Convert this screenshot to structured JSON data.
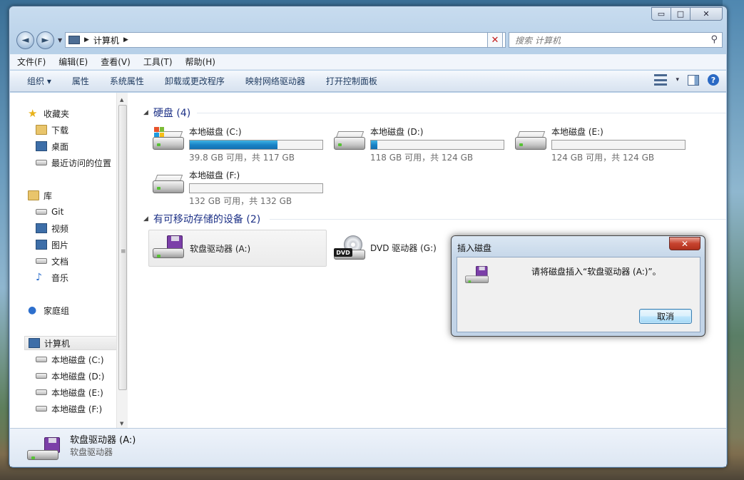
{
  "window": {
    "caption_buttons": {
      "minimize": "▭",
      "maximize": "□",
      "close": "✕"
    }
  },
  "navbar": {
    "back_glyph": "◄",
    "forward_glyph": "►",
    "address_path": "计算机",
    "address_arrow": "▶",
    "refresh_glyph": "✕",
    "search_placeholder": "搜索 计算机",
    "search_icon": "⚲"
  },
  "menubar": {
    "items": [
      "文件(F)",
      "编辑(E)",
      "查看(V)",
      "工具(T)",
      "帮助(H)"
    ]
  },
  "cmdbar": {
    "organize": "组织 ▾",
    "items": [
      "属性",
      "系统属性",
      "卸载或更改程序",
      "映射网络驱动器",
      "打开控制面板"
    ],
    "view_dd": "▾",
    "help": "?"
  },
  "navpane": {
    "favorites": {
      "label": "收藏夹",
      "items": [
        "下载",
        "桌面",
        "最近访问的位置"
      ]
    },
    "libraries": {
      "label": "库",
      "items": [
        "Git",
        "视频",
        "图片",
        "文档",
        "音乐"
      ]
    },
    "homegroup": {
      "label": "家庭组"
    },
    "computer": {
      "label": "计算机",
      "items": [
        "本地磁盘 (C:)",
        "本地磁盘 (D:)",
        "本地磁盘 (E:)",
        "本地磁盘 (F:)"
      ]
    }
  },
  "main": {
    "hdd_group": "硬盘 (4)",
    "removable_group": "有可移动存储的设备 (2)",
    "drives": [
      {
        "name": "本地磁盘 (C:)",
        "free": "39.8 GB 可用，共 117 GB",
        "used_fraction": 0.66
      },
      {
        "name": "本地磁盘 (D:)",
        "free": "118 GB 可用，共 124 GB",
        "used_fraction": 0.05
      },
      {
        "name": "本地磁盘 (E:)",
        "free": "124 GB 可用，共 124 GB",
        "used_fraction": 0.0
      },
      {
        "name": "本地磁盘 (F:)",
        "free": "132 GB 可用，共 132 GB",
        "used_fraction": 0.0
      }
    ],
    "removable": [
      {
        "name": "软盘驱动器 (A:)"
      },
      {
        "name": "DVD 驱动器 (G:)",
        "badge": "DVD"
      }
    ]
  },
  "details": {
    "name": "软盘驱动器 (A:)",
    "type": "软盘驱动器"
  },
  "dialog": {
    "title": "插入磁盘",
    "message": "请将磁盘插入“软盘驱动器 (A:)”。",
    "cancel_label": "取消",
    "close_glyph": "✕"
  }
}
